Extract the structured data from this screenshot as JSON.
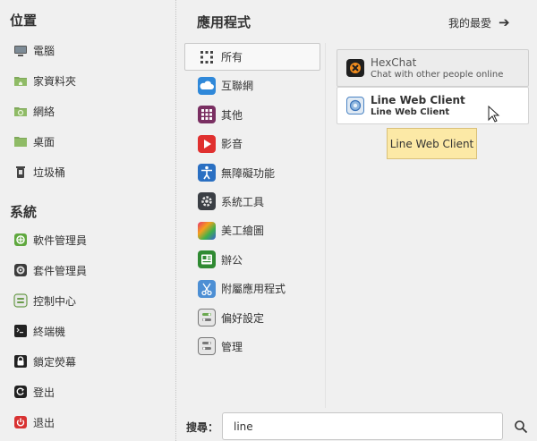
{
  "places": {
    "title": "位置",
    "items": [
      {
        "label": "電腦",
        "icon": "computer-icon"
      },
      {
        "label": "家資料夾",
        "icon": "home-folder-icon"
      },
      {
        "label": "網絡",
        "icon": "network-icon"
      },
      {
        "label": "桌面",
        "icon": "desktop-icon"
      },
      {
        "label": "垃圾桶",
        "icon": "trash-icon"
      }
    ]
  },
  "system": {
    "title": "系統",
    "items": [
      {
        "label": "軟件管理員",
        "icon": "software-manager-icon"
      },
      {
        "label": "套件管理員",
        "icon": "package-manager-icon"
      },
      {
        "label": "控制中心",
        "icon": "control-center-icon"
      },
      {
        "label": "終端機",
        "icon": "terminal-icon"
      },
      {
        "label": "鎖定熒幕",
        "icon": "lock-screen-icon"
      },
      {
        "label": "登出",
        "icon": "logout-icon"
      },
      {
        "label": "退出",
        "icon": "power-icon"
      }
    ]
  },
  "applications": {
    "title": "應用程式",
    "favorites_label": "我的最愛",
    "categories": [
      {
        "label": "所有",
        "icon": "all-apps-icon",
        "selected": true
      },
      {
        "label": "互聯網",
        "icon": "internet-icon"
      },
      {
        "label": "其他",
        "icon": "other-icon"
      },
      {
        "label": "影音",
        "icon": "multimedia-icon"
      },
      {
        "label": "無障礙功能",
        "icon": "accessibility-icon"
      },
      {
        "label": "系統工具",
        "icon": "system-tools-icon"
      },
      {
        "label": "美工繪圖",
        "icon": "graphics-icon"
      },
      {
        "label": "辦公",
        "icon": "office-icon"
      },
      {
        "label": "附屬應用程式",
        "icon": "accessories-icon"
      },
      {
        "label": "偏好設定",
        "icon": "preferences-icon"
      },
      {
        "label": "管理",
        "icon": "administration-icon"
      }
    ]
  },
  "results": [
    {
      "name": "HexChat",
      "description": "Chat with other people online",
      "icon": "hexchat-icon"
    },
    {
      "name": "Line Web Client",
      "description": "Line Web Client",
      "icon": "line-web-client-icon"
    }
  ],
  "tooltip": "Line Web Client",
  "search": {
    "label": "搜尋：",
    "value": "line"
  },
  "colors": {
    "accent_green": "#6aa84f",
    "tooltip_bg": "#fce9a6",
    "selected_border": "#c8c8c8"
  }
}
